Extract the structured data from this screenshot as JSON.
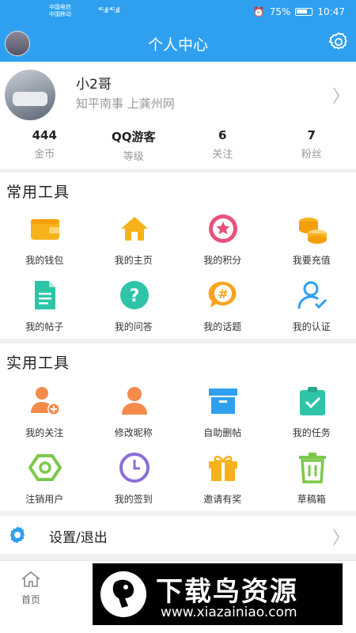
{
  "status_bar": {
    "carrier1": "中国电信",
    "carrier2": "中国移动",
    "signal": "⁴ᴳ.ıll ⁴ᴳ.ıll",
    "battery": "75%",
    "time": "10:47"
  },
  "nav": {
    "title": "个人中心"
  },
  "profile": {
    "name": "小2哥",
    "signature": "知平南事 上龚州网",
    "stats": [
      {
        "value": "444",
        "label": "金币"
      },
      {
        "value": "QQ游客",
        "label": "等级"
      },
      {
        "value": "6",
        "label": "关注"
      },
      {
        "value": "7",
        "label": "粉丝"
      }
    ]
  },
  "common_tools": {
    "title": "常用工具",
    "items": [
      {
        "label": "我的钱包",
        "icon": "wallet-icon",
        "color": "#f7b21b"
      },
      {
        "label": "我的主页",
        "icon": "home-icon",
        "color": "#f7b21b"
      },
      {
        "label": "我的积分",
        "icon": "star-badge-icon",
        "color": "#e8527b"
      },
      {
        "label": "我要充值",
        "icon": "coins-icon",
        "color": "#f7b21b"
      },
      {
        "label": "我的帖子",
        "icon": "document-icon",
        "color": "#2ec4a8"
      },
      {
        "label": "我的问答",
        "icon": "question-icon",
        "color": "#2ec4a8"
      },
      {
        "label": "我的话题",
        "icon": "hashtag-icon",
        "color": "#f7a31b"
      },
      {
        "label": "我的认证",
        "icon": "verified-user-icon",
        "color": "#2fa0f0"
      }
    ]
  },
  "practical_tools": {
    "title": "实用工具",
    "items": [
      {
        "label": "我的关注",
        "icon": "add-user-icon",
        "color": "#f58a4a"
      },
      {
        "label": "修改昵称",
        "icon": "user-icon",
        "color": "#f58a4a"
      },
      {
        "label": "自助删帖",
        "icon": "archive-icon",
        "color": "#2fa0f0"
      },
      {
        "label": "我的任务",
        "icon": "task-icon",
        "color": "#2ec4a8"
      },
      {
        "label": "注销用户",
        "icon": "hexagon-icon",
        "color": "#7cc94a"
      },
      {
        "label": "我的签到",
        "icon": "clock-icon",
        "color": "#8a6fd6"
      },
      {
        "label": "邀请有奖",
        "icon": "gift-icon",
        "color": "#f7b21b"
      },
      {
        "label": "草稿箱",
        "icon": "trash-icon",
        "color": "#7cc94a"
      }
    ]
  },
  "settings_row": {
    "label": "设置/退出"
  },
  "tab_bar": {
    "home_label": "首页"
  },
  "watermark": {
    "title": "下载鸟资源",
    "url": "www.xiazainiao.com"
  },
  "colors": {
    "primary": "#2fa0f0",
    "background": "#f0f0f0"
  }
}
